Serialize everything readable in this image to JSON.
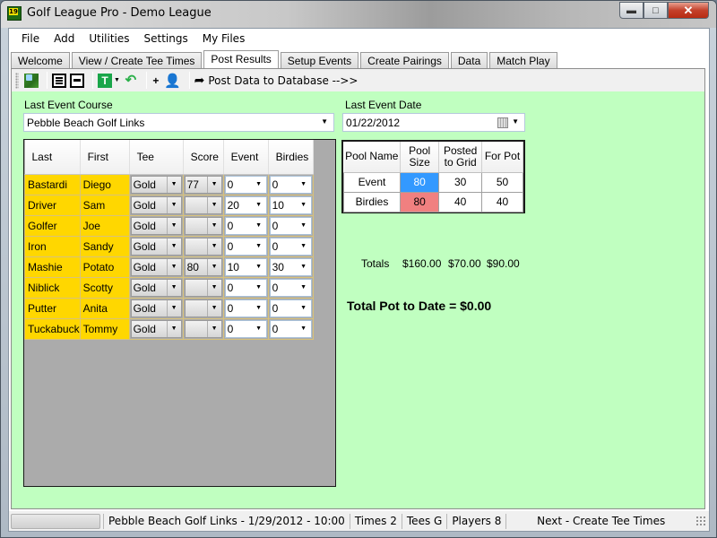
{
  "window": {
    "title": "Golf League Pro - Demo League",
    "icon_label": "19",
    "controls": [
      "minimize",
      "maximize",
      "close"
    ]
  },
  "menu": [
    "File",
    "Add",
    "Utilities",
    "Settings",
    "My Files"
  ],
  "tabs": [
    {
      "label": "Welcome",
      "active": false
    },
    {
      "label": "View / Create Tee Times",
      "active": false
    },
    {
      "label": "Post Results",
      "active": true
    },
    {
      "label": "Setup Events",
      "active": false
    },
    {
      "label": "Create Pairings",
      "active": false
    },
    {
      "label": "Data",
      "active": false
    },
    {
      "label": "Match Play",
      "active": false
    }
  ],
  "toolbar": {
    "icons": [
      "course-map-icon",
      "list-view-icon",
      "single-view-icon",
      "tee-icon",
      "undo-icon",
      "add-icon",
      "player-icon"
    ],
    "post_label": "Post Data to Database -->>"
  },
  "course": {
    "label": "Last Event Course",
    "value": "Pebble Beach Golf Links"
  },
  "date": {
    "label": "Last Event Date",
    "value": "01/22/2012"
  },
  "grid": {
    "columns": [
      "Last",
      "First",
      "Tee",
      "Score",
      "Event",
      "Birdies"
    ],
    "rows": [
      {
        "last": "Bastardi",
        "first": "Diego",
        "tee": "Gold",
        "score": "77",
        "event": "0",
        "birdies": "0"
      },
      {
        "last": "Driver",
        "first": "Sam",
        "tee": "Gold",
        "score": "",
        "event": "20",
        "birdies": "10"
      },
      {
        "last": "Golfer",
        "first": "Joe",
        "tee": "Gold",
        "score": "",
        "event": "0",
        "birdies": "0"
      },
      {
        "last": "Iron",
        "first": "Sandy",
        "tee": "Gold",
        "score": "",
        "event": "0",
        "birdies": "0"
      },
      {
        "last": "Mashie",
        "first": "Potato",
        "tee": "Gold",
        "score": "80",
        "event": "10",
        "birdies": "30"
      },
      {
        "last": "Niblick",
        "first": "Scotty",
        "tee": "Gold",
        "score": "",
        "event": "0",
        "birdies": "0"
      },
      {
        "last": "Putter",
        "first": "Anita",
        "tee": "Gold",
        "score": "",
        "event": "0",
        "birdies": "0"
      },
      {
        "last": "Tuckabuck",
        "first": "Tommy",
        "tee": "Gold",
        "score": "",
        "event": "0",
        "birdies": "0"
      }
    ]
  },
  "pool": {
    "columns": [
      "Pool Name",
      "Pool Size",
      "Posted to Grid",
      "For Pot"
    ],
    "rows": [
      {
        "name": "Event",
        "size": "80",
        "posted": "30",
        "for_pot": "50",
        "size_color": "#3399ff"
      },
      {
        "name": "Birdies",
        "size": "80",
        "posted": "40",
        "for_pot": "40",
        "size_color": "#f08080"
      }
    ],
    "totals_label": "Totals",
    "totals": {
      "size": "$160.00",
      "posted": "$70.00",
      "for_pot": "$90.00"
    }
  },
  "total_pot": "Total Pot to Date = $0.00",
  "status": {
    "event": "Pebble Beach Golf Links - 1/29/2012 - 10:00",
    "times": "Times 2",
    "tees": "Tees G",
    "players": "Players 8",
    "next": "Next - Create Tee Times"
  },
  "colors": {
    "panel_bg": "#c0ffc0",
    "name_cell": "#ffd700",
    "grid_bg": "#ababab"
  }
}
